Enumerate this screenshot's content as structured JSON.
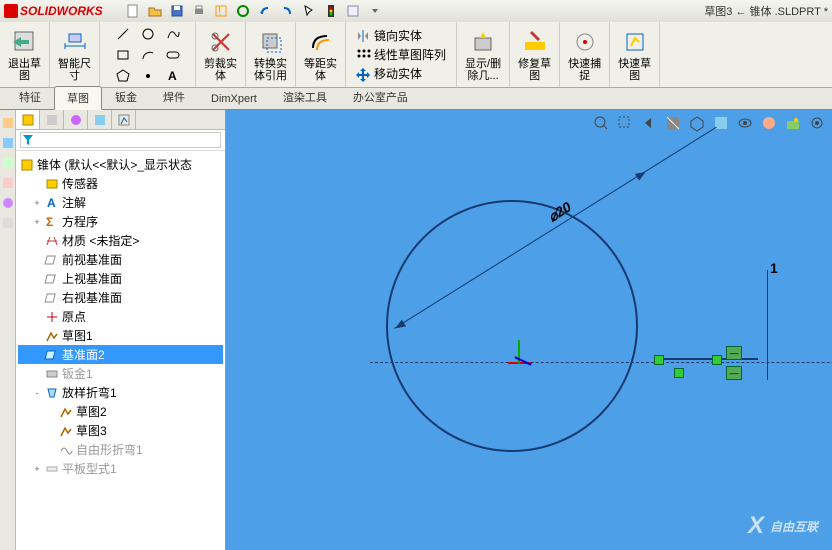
{
  "app": {
    "name": "SOLIDWORKS",
    "doc_title": "草图3 ← 锥体 .SLDPRT *"
  },
  "qat_icons": [
    "new",
    "open",
    "save",
    "print",
    "sketch-check",
    "rebuild",
    "options",
    "undo",
    "redo",
    "select",
    "view-settings",
    "close-doc",
    "macro",
    "dropdown"
  ],
  "ribbon": {
    "exit_sketch": "退出草\n图",
    "smart_dim": "智能尺\n寸",
    "trim": "剪裁实\n体",
    "convert": "转换实\n体引用",
    "offset": "等距实\n体",
    "mirror": "镜向实体",
    "pattern": "线性草图阵列",
    "move": "移动实体",
    "show_hide": "显示/删\n除几...",
    "repair": "修复草\n图",
    "quick_snap": "快速捕\n捉",
    "rapid_sketch": "快速草\n图"
  },
  "tabs": [
    "特征",
    "草图",
    "钣金",
    "焊件",
    "DimXpert",
    "渲染工具",
    "办公室产品"
  ],
  "active_tab": "草图",
  "tree": {
    "root": "锥体  (默认<<默认>_显示状态",
    "items": [
      {
        "icon": "sensor",
        "label": "传感器",
        "ind": 1
      },
      {
        "icon": "annotation",
        "label": "注解",
        "ind": 1,
        "exp": "+"
      },
      {
        "icon": "equation",
        "label": "方程序",
        "ind": 1,
        "exp": "+"
      },
      {
        "icon": "material",
        "label": "材质 <未指定>",
        "ind": 1
      },
      {
        "icon": "plane",
        "label": "前视基准面",
        "ind": 1
      },
      {
        "icon": "plane",
        "label": "上视基准面",
        "ind": 1
      },
      {
        "icon": "plane",
        "label": "右视基准面",
        "ind": 1
      },
      {
        "icon": "origin",
        "label": "原点",
        "ind": 1
      },
      {
        "icon": "sketch",
        "label": "草图1",
        "ind": 1
      },
      {
        "icon": "plane-sel",
        "label": "基准面2",
        "ind": 1,
        "sel": true
      },
      {
        "icon": "sheetmetal",
        "label": "钣金1",
        "ind": 1,
        "dim": true
      },
      {
        "icon": "loft",
        "label": "放样折弯1",
        "ind": 1,
        "exp": "-"
      },
      {
        "icon": "sketch",
        "label": "草图2",
        "ind": 2
      },
      {
        "icon": "sketch",
        "label": "草图3",
        "ind": 2
      },
      {
        "icon": "freeform",
        "label": "自由形折弯1",
        "ind": 2,
        "dim": true
      },
      {
        "icon": "flat",
        "label": "平板型式1",
        "ind": 1,
        "exp": "+",
        "dim": true
      }
    ]
  },
  "sketch": {
    "diameter_label": "⌀20",
    "dim1_label": "1"
  },
  "watermark": {
    "x": "X",
    "text": "自由互联"
  }
}
